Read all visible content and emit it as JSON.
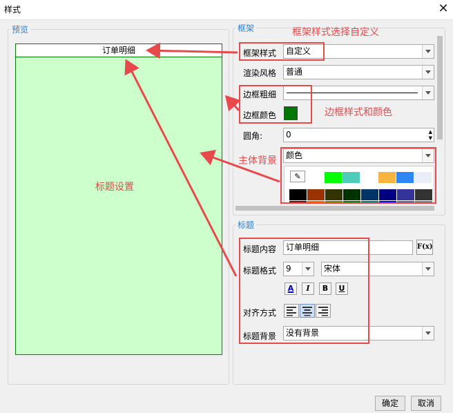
{
  "window": {
    "title": "样式",
    "close_glyph": "✕"
  },
  "preview": {
    "legend": "预览",
    "title_text": "订单明细",
    "body_color": "#ccffcc",
    "border_color": "#008000"
  },
  "frame": {
    "legend": "框架",
    "style_label": "框架样式",
    "style_value": "自定义",
    "render_label": "渲染风格",
    "render_value": "普通",
    "border_width_label": "边框粗细",
    "border_color_label": "边框颜色",
    "border_color_value": "#007800",
    "radius_label": "圆角:",
    "radius_value": "0",
    "bg_label": "主体背景",
    "bg_value": "颜色",
    "palette_row1": [
      "#00ff00",
      "#4ecbb9",
      "#ffffff",
      "#f7b53d",
      "#2f86f5",
      "#e9eef8"
    ],
    "palette_row2": [
      "#000000",
      "#993300",
      "#333300",
      "#003300",
      "#003366",
      "#000080",
      "#333399",
      "#333333"
    ],
    "palette_row3": [
      "#800000",
      "#ff6600",
      "#808000",
      "#008000",
      "#008080",
      "#0000ff",
      "#666699",
      "#808080"
    ]
  },
  "title_section": {
    "legend": "标题",
    "content_label": "标题内容",
    "content_value": "订单明细",
    "fx_label": "F(x)",
    "format_label": "标题格式",
    "font_size": "9",
    "font_name": "宋体",
    "bold": "B",
    "italic": "I",
    "underline": "U",
    "color_btn": "A",
    "align_label": "对齐方式",
    "bg_label": "标题背景",
    "bg_value": "没有背景"
  },
  "annotations": {
    "frame_style": "框架样式选择自定义",
    "border_style": "边框样式和颜色",
    "body_bg": "主体背景",
    "title_setting": "标题设置"
  },
  "footer": {
    "ok": "确定",
    "cancel": "取消"
  }
}
